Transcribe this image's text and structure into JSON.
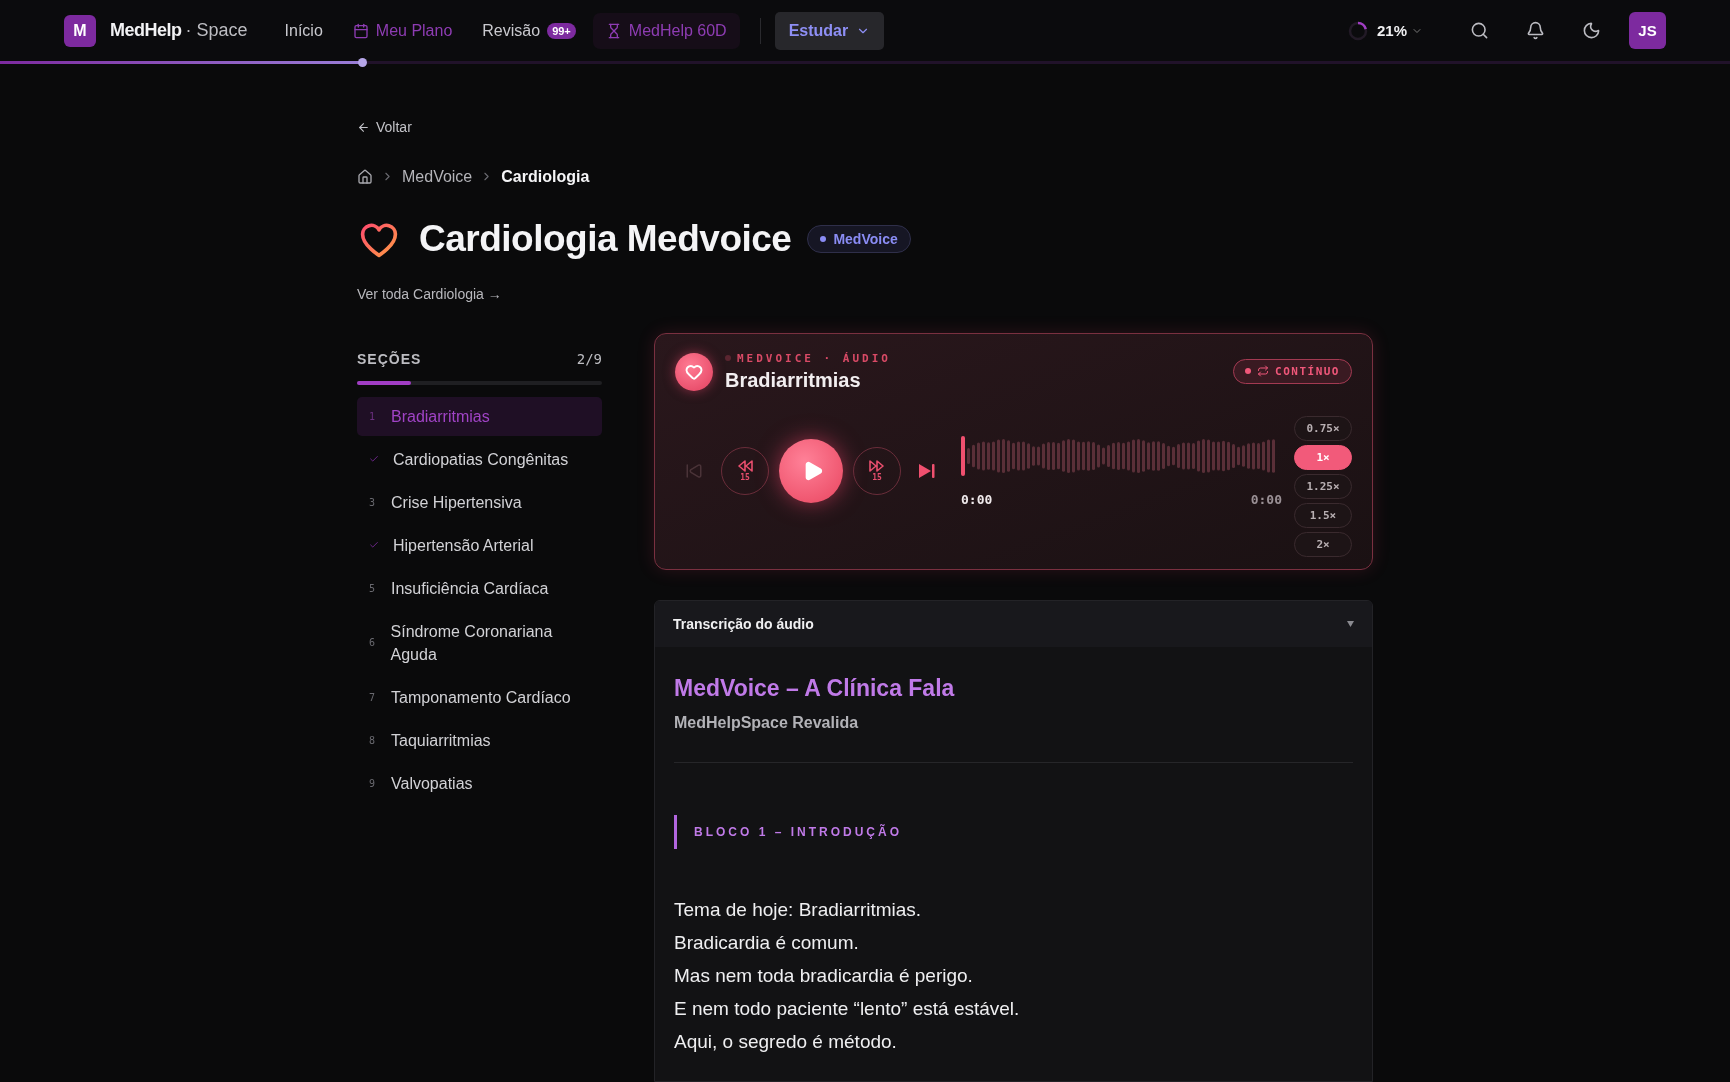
{
  "nav": {
    "logo_letter": "M",
    "brand": "MedHelp",
    "brand_suffix": "· Space",
    "links": [
      {
        "kind": "plain",
        "label": "Início"
      },
      {
        "kind": "calendar",
        "label": "Meu Plano"
      },
      {
        "kind": "badge",
        "label": "Revisão",
        "badge": "99+"
      },
      {
        "kind": "hourglass",
        "label": "MedHelp 60D"
      }
    ],
    "study_button": "Estudar",
    "progress": {
      "label": "21%",
      "level": 0.21
    },
    "avatar": "JS"
  },
  "page_progress": {
    "level": 0.21
  },
  "back_link": "Voltar",
  "breadcrumb": [
    {
      "label": "MedVoice",
      "current": false
    },
    {
      "label": "Cardiologia",
      "current": true
    }
  ],
  "title": "Cardiologia Medvoice",
  "tag": "MedVoice",
  "see_all": "Ver toda Cardiologia →",
  "sections": {
    "heading": "SEÇÕES",
    "count": "2/9",
    "level": 0.22,
    "items": [
      {
        "number": "1",
        "label": "Bradiarritmias",
        "done": false,
        "selected": true
      },
      {
        "label": "Cardiopatias Congênitas",
        "done": true,
        "selected": false
      },
      {
        "number": "3",
        "label": "Crise Hipertensiva",
        "done": false,
        "selected": false
      },
      {
        "label": "Hipertensão Arterial",
        "done": true,
        "selected": false
      },
      {
        "number": "5",
        "label": "Insuficiência Cardíaca",
        "done": false,
        "selected": false
      },
      {
        "number": "6",
        "label": "Síndrome Coronariana Aguda",
        "done": false,
        "selected": false
      },
      {
        "number": "7",
        "label": "Tamponamento Cardíaco",
        "done": false,
        "selected": false
      },
      {
        "number": "8",
        "label": "Taquiarritmias",
        "done": false,
        "selected": false
      },
      {
        "number": "9",
        "label": "Valvopatias",
        "done": false,
        "selected": false
      }
    ]
  },
  "player": {
    "eyebrow": "MEDVOICE · ÁUDIO",
    "title": "Bradiarritmias",
    "mode": "CONTÍNUO",
    "previous_disabled": true,
    "back_skip": "15",
    "forward_skip": "15",
    "playing": false,
    "level": 0,
    "elapsed": "0:00",
    "duration": "0:00",
    "speeds": [
      {
        "label": "0.75×",
        "selected": false
      },
      {
        "label": "1×",
        "selected": true
      },
      {
        "label": "1.25×",
        "selected": false
      },
      {
        "label": "1.5×",
        "selected": false
      },
      {
        "label": "2×",
        "selected": false
      }
    ]
  },
  "transcript": {
    "title": "Transcrição do áudio",
    "expanded": true,
    "heading": "MedVoice – A Clínica Fala",
    "subheading": "MedHelpSpace Revalida",
    "block": "BLOCO 1 – INTRODUÇÃO",
    "lines": [
      "Tema de hoje: Bradiarritmias.",
      "Bradicardia é comum.",
      "Mas nem toda bradicardia é perigo.",
      "E nem todo paciente “lento” está estável.",
      "Aqui, o segredo é método."
    ]
  }
}
